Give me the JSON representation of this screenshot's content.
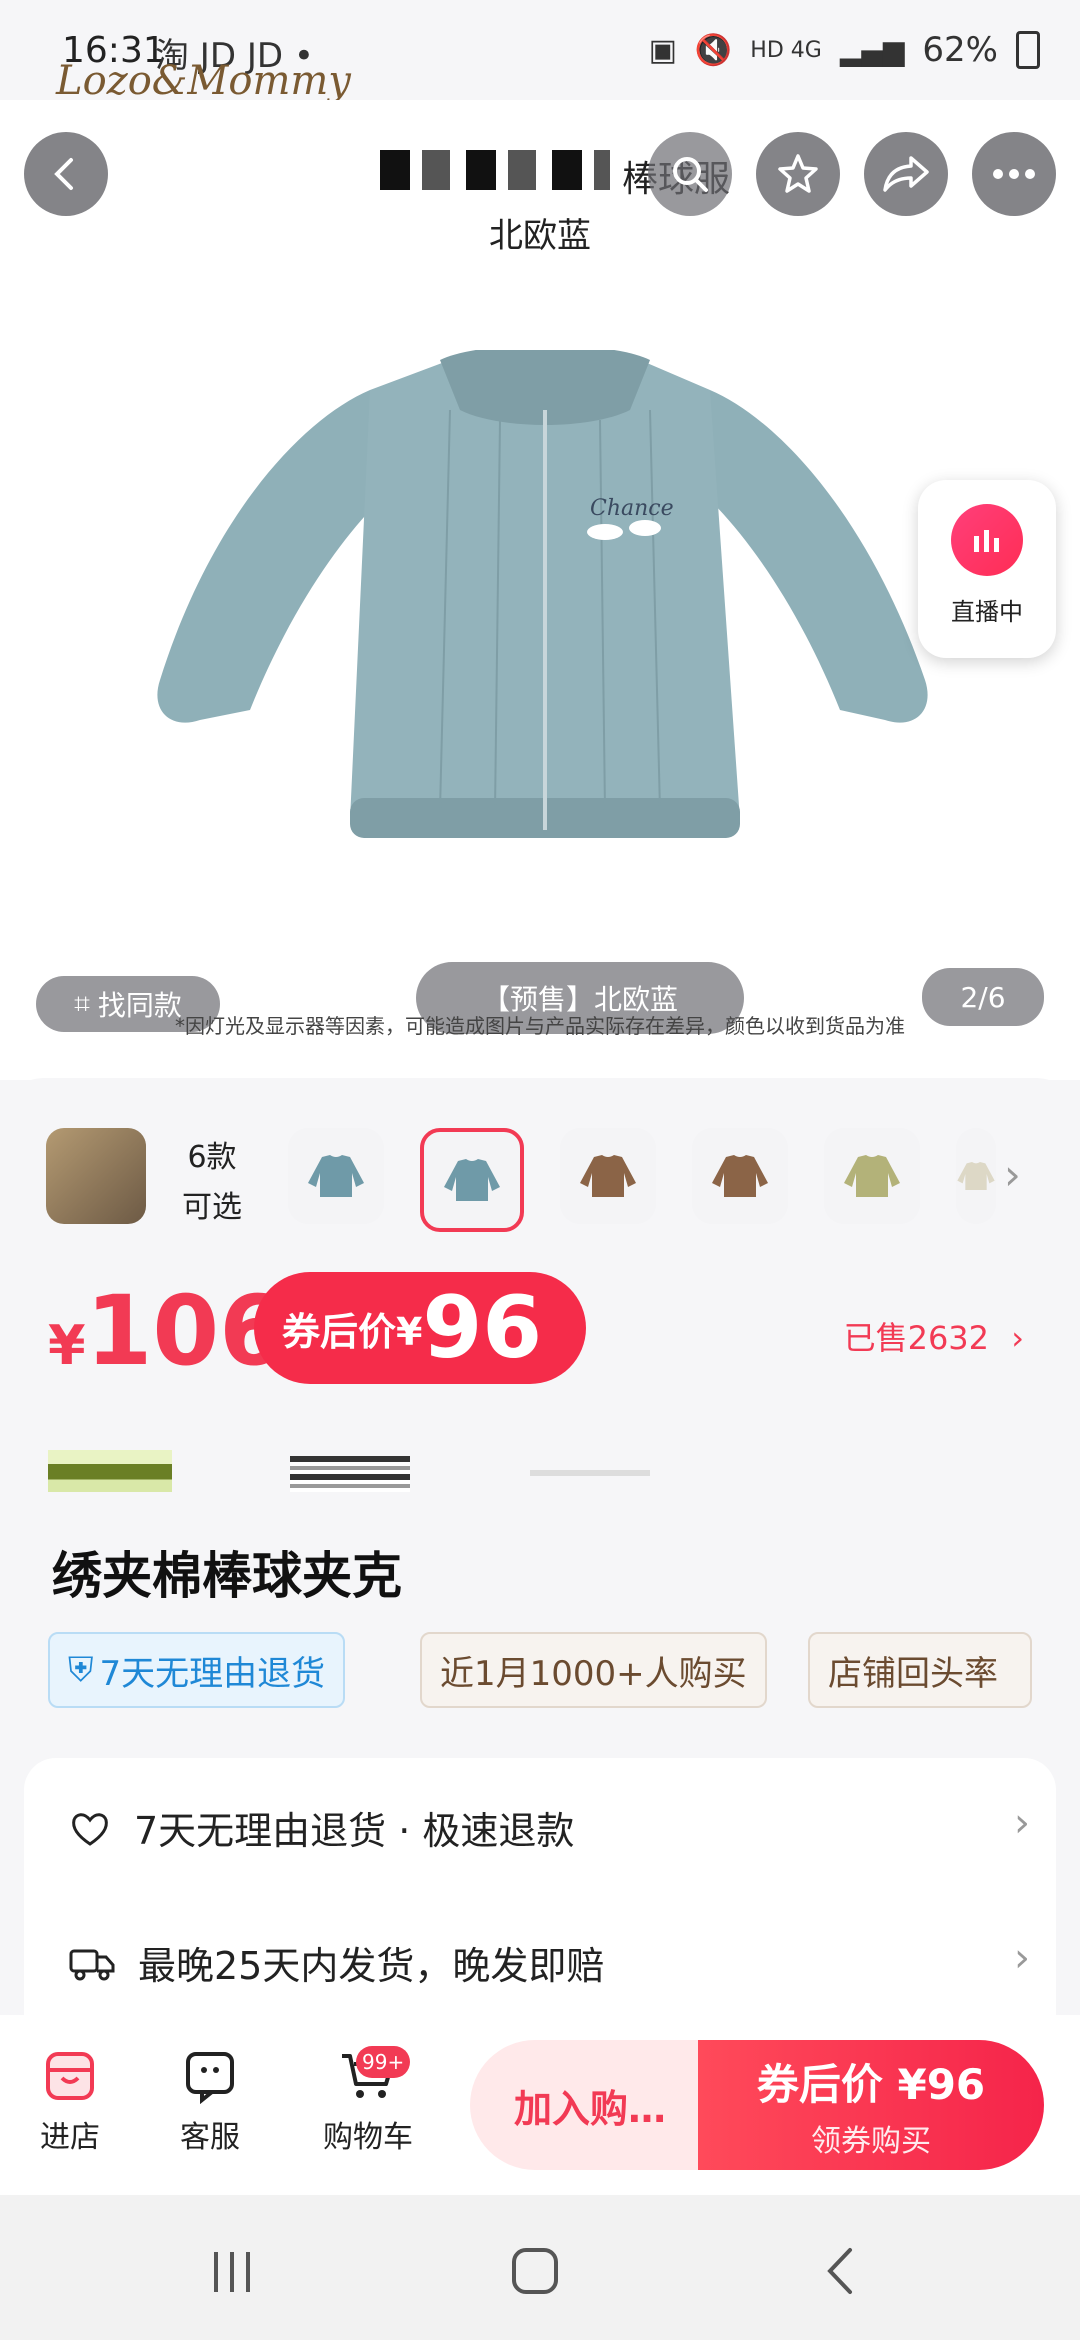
{
  "status_bar": {
    "time": "16:31",
    "apps": "淘 JD JD •",
    "network": "HD 4G",
    "battery": "62%"
  },
  "brand": "Lozo&Mommy",
  "header": {
    "title_suffix": "棒球服",
    "subtitle": "北欧蓝"
  },
  "live": {
    "label": "直播中"
  },
  "image_bar": {
    "find_similar": "找同款",
    "variant_label": "【预售】北欧蓝",
    "counter": "2/6",
    "disclaimer": "*因灯光及显示器等因素，可能造成图片与产品实际存在差异，颜色以收到货品为准"
  },
  "variants": {
    "count_label": "6款",
    "count_sub": "可选",
    "colors": [
      "#6f9aa8",
      "#6f9aa8",
      "#8b6447",
      "#8b6447",
      "#b3b279",
      "#ddd8c6"
    ]
  },
  "price": {
    "currency": "¥",
    "value": "106",
    "coupon_prefix": "券后价¥",
    "coupon_value": "96",
    "sold": "已售2632"
  },
  "product": {
    "title": "绣夹棉棒球夹克",
    "tags": [
      "7天无理由退货",
      "近1月1000+人购买",
      "店铺回头率"
    ]
  },
  "services": [
    {
      "text": "7天无理由退货 · 极速退款",
      "icon": "heart-shield-icon"
    },
    {
      "text": "最晚25天内发货，晚发即赔",
      "icon": "truck-icon"
    }
  ],
  "bottom_bar": {
    "store": "进店",
    "service": "客服",
    "cart": "购物车",
    "cart_badge": "99+",
    "add_to_cart": "加入购…",
    "buy_price": "券后价 ¥96",
    "buy_sub": "领券购买"
  },
  "colors": {
    "accent": "#f23a54",
    "jacket": "#8fb0b8"
  }
}
